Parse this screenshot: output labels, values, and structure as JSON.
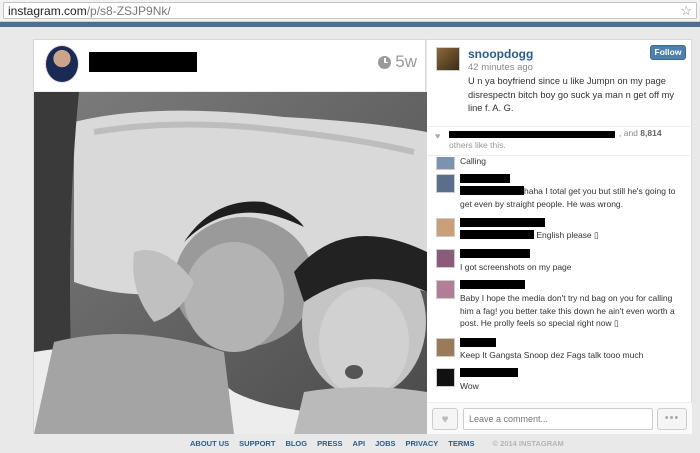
{
  "browser": {
    "url_host": "instagram.com",
    "url_path": "/p/s8-ZSJP9Nk/",
    "bookmark_icon": "star-icon"
  },
  "post": {
    "time_ago": "5w"
  },
  "caption": {
    "username": "snoopdogg",
    "time": "42 minutes ago",
    "text": "U n ya boyfriend since u like Jumpn on my page disrespectn bitch boy go suck ya man n get off my line f. A. G.",
    "follow_label": "Follow"
  },
  "likes": {
    "and_text": ", and",
    "count": "8,814",
    "others_text": "others like this."
  },
  "comments": [
    {
      "text": "Calling",
      "avatar_color": "#7a93b0"
    },
    {
      "text": "haha I total get you but still he's going to get even by straight people. He was wrong.",
      "avatar_color": "#5b6f8c"
    },
    {
      "text": "English please",
      "avatar_color": "#c9a07a"
    },
    {
      "text": "I got screenshots on my page",
      "avatar_color": "#8c5b7a"
    },
    {
      "text": "Baby I hope the media don't try nd bag on you for calling him a fag! you better take this down he ain't even worth a post. He prolly feels so special right now",
      "avatar_color": "#b07e96"
    },
    {
      "text": "Keep It Gangsta Snoop dez Fags talk tooo much",
      "avatar_color": "#9b7a5a"
    },
    {
      "text": "Wow",
      "avatar_color": "#111111"
    }
  ],
  "comment_input": {
    "placeholder": "Leave a comment..."
  },
  "footer": {
    "links": [
      "ABOUT US",
      "SUPPORT",
      "BLOG",
      "PRESS",
      "API",
      "JOBS",
      "PRIVACY",
      "TERMS"
    ],
    "copyright": "© 2014 INSTAGRAM"
  }
}
